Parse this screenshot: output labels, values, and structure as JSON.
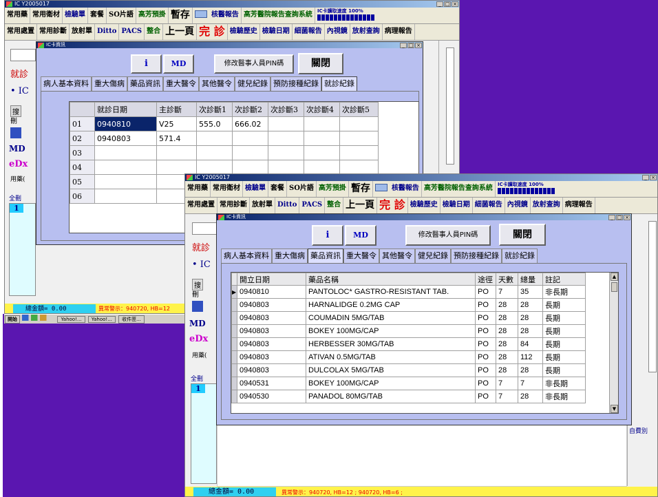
{
  "back_window": {
    "title": "IC Y2005017",
    "menu1": [
      "常用藥",
      "常用衛材",
      "檢驗單",
      "套餐",
      "SO片語",
      "高芳預掛",
      "暫存",
      "",
      "核醫報告",
      "高芳醫院報告查詢系統"
    ],
    "progress": "IC卡讀取速度 100%",
    "menu2": [
      "常用處置",
      "常用診斷",
      "放射單",
      "Ditto",
      "PACS",
      "整合",
      "上一頁",
      "完 診",
      "檢驗歷史",
      "檢驗日期",
      "細菌報告",
      "內視鏡",
      "放射查詢",
      "病理報告"
    ],
    "side_labels": [
      "就診",
      "• IC",
      "搜",
      "刪",
      "MD",
      "eDx",
      "用藥(",
      "全刪",
      "1"
    ],
    "status_total": "總金額= 0.00",
    "status_warn": "異常警示：940720, HB=12",
    "taskbar_items": [
      "開始",
      "Yahoo!...",
      "Yahoo!...",
      "收件匣..."
    ]
  },
  "front_window": {
    "title": "IC Y2005017",
    "side_labels": [
      "就診",
      "• IC",
      "搜",
      "刪",
      "MD",
      "eDx",
      "用藥(",
      "全刪",
      "1"
    ],
    "right_label": "自費別",
    "status_total": "總金額= 0.00",
    "status_warn": "異常警示：940720, HB=12 ; 940720, HB=6 ;"
  },
  "dialog": {
    "title": "IC卡資訊",
    "info_btn": "i",
    "md_btn": "MD",
    "pin_btn": "修改醫事人員PIN碼",
    "close_btn": "關閉",
    "tabs": [
      "病人基本資料",
      "重大傷病",
      "藥品資訊",
      "重大醫令",
      "其他醫令",
      "健兒紀錄",
      "預防接種紀錄",
      "就診紀錄"
    ]
  },
  "visit_table": {
    "headers": [
      "就診日期",
      "主診斷",
      "次診斷1",
      "次診斷2",
      "次診斷3",
      "次診斷4",
      "次診斷5"
    ],
    "rows": [
      {
        "n": "01",
        "date": "0940810",
        "main": "V25",
        "d1": "555.0",
        "d2": "666.02"
      },
      {
        "n": "02",
        "date": "0940803",
        "main": "571.4",
        "d1": "",
        "d2": ""
      },
      {
        "n": "03",
        "date": "",
        "main": "",
        "d1": "",
        "d2": ""
      },
      {
        "n": "04",
        "date": "",
        "main": "",
        "d1": "",
        "d2": ""
      },
      {
        "n": "05",
        "date": "",
        "main": "",
        "d1": "",
        "d2": ""
      },
      {
        "n": "06",
        "date": "",
        "main": "",
        "d1": "",
        "d2": ""
      }
    ]
  },
  "drug_table": {
    "headers": [
      "開立日期",
      "藥品名稱",
      "途徑",
      "天數",
      "總量",
      "註記"
    ],
    "rows": [
      {
        "date": "0940810",
        "name": "PANTOLOC* GASTRO-RESISTANT TAB.",
        "route": "PO",
        "days": "7",
        "total": "35",
        "note": "非長期"
      },
      {
        "date": "0940803",
        "name": "HARNALIDGE 0.2MG CAP",
        "route": "PO",
        "days": "28",
        "total": "28",
        "note": "長期"
      },
      {
        "date": "0940803",
        "name": "COUMADIN 5MG/TAB",
        "route": "PO",
        "days": "28",
        "total": "28",
        "note": "長期"
      },
      {
        "date": "0940803",
        "name": "BOKEY 100MG/CAP",
        "route": "PO",
        "days": "28",
        "total": "28",
        "note": "長期"
      },
      {
        "date": "0940803",
        "name": "HERBESSER 30MG/TAB",
        "route": "PO",
        "days": "28",
        "total": "84",
        "note": "長期"
      },
      {
        "date": "0940803",
        "name": "ATIVAN 0.5MG/TAB",
        "route": "PO",
        "days": "28",
        "total": "112",
        "note": "長期"
      },
      {
        "date": "0940803",
        "name": "DULCOLAX 5MG/TAB",
        "route": "PO",
        "days": "28",
        "total": "28",
        "note": "長期"
      },
      {
        "date": "0940531",
        "name": "BOKEY 100MG/CAP",
        "route": "PO",
        "days": "7",
        "total": "7",
        "note": "非長期"
      },
      {
        "date": "0940530",
        "name": "PANADOL 80MG/TAB",
        "route": "PO",
        "days": "7",
        "total": "28",
        "note": "非長期"
      }
    ]
  },
  "colors": {
    "desktop": "#5a16b0",
    "dialog_bg": "#b8bff0",
    "selection": "#0a246a",
    "status_bg": "#fff34a"
  }
}
